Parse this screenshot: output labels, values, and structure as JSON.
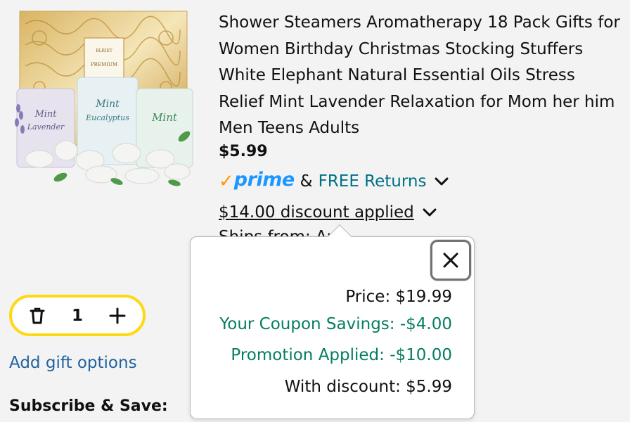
{
  "product": {
    "title": "Shower Steamers Aromatherapy 18 Pack Gifts for Women Birthday Christmas Stocking Stuffers White Elephant Natural Essential Oils Stress Relief Mint Lavender Relaxation for Mom her him Men Teens Adults",
    "price": "$5.99",
    "image": {
      "brand": "BLRIET",
      "box_label": "PREMIUM",
      "bag_labels": [
        "Mint Lavender",
        "Mint Eucalyptus",
        "Mint"
      ]
    }
  },
  "shipping": {
    "prime_label": "prime",
    "amp": "&",
    "free_returns": "FREE Returns",
    "discount_label": "$14.00 discount applied",
    "ships_from_partial": "Ships from: Am"
  },
  "quantity": {
    "value": "1",
    "delete_icon": "trash-icon",
    "plus_icon": "plus-icon"
  },
  "links": {
    "add_gift_options": "Add gift options"
  },
  "subscribe": {
    "label": "Subscribe & Save:"
  },
  "discount_popover": {
    "price_line": "Price: $19.99",
    "coupon_line": "Your Coupon Savings: -$4.00",
    "promo_line": "Promotion Applied: -$10.00",
    "final_line": "With discount: $5.99",
    "close_icon": "close-icon"
  },
  "colors": {
    "background": "#f3f3f3",
    "link": "#007185",
    "gift_link": "#2162a1",
    "savings_green": "#067d62",
    "prime_blue": "#1a98ff",
    "prime_orange": "#ff9900",
    "stepper_border": "#ffd814"
  }
}
